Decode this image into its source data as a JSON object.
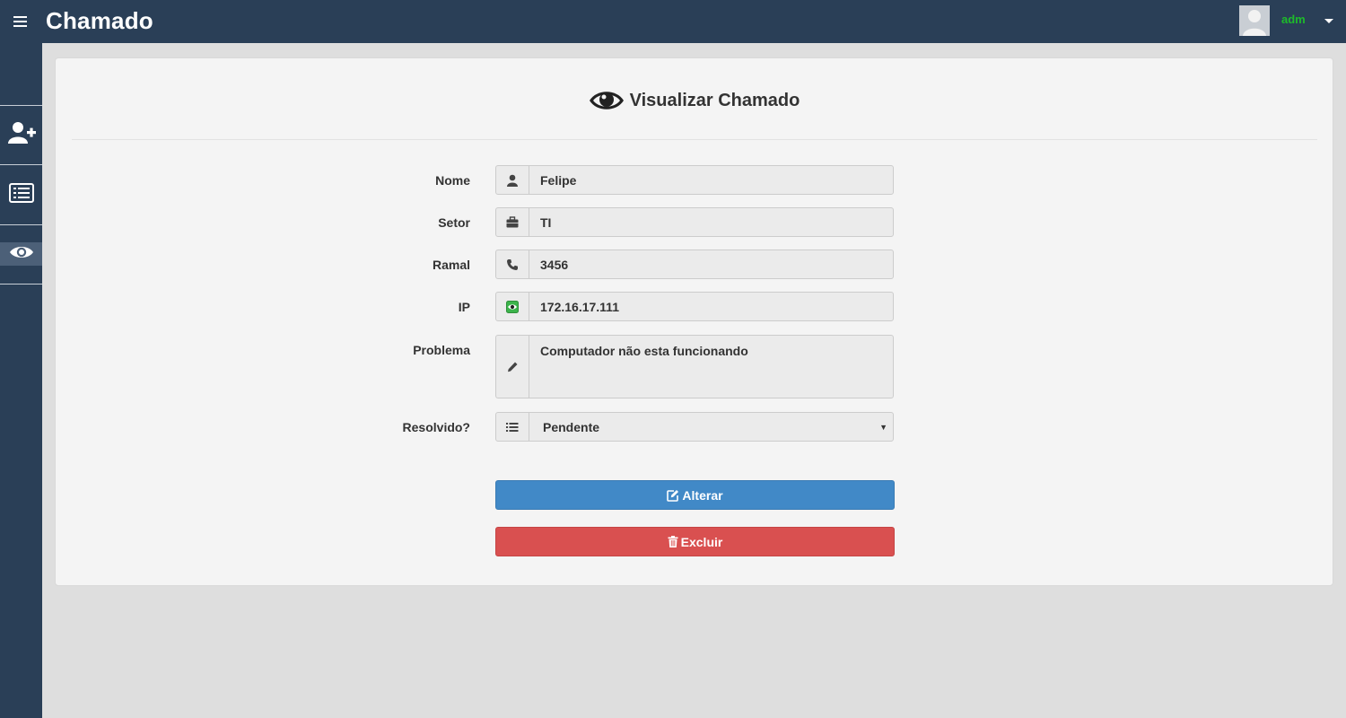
{
  "app": {
    "brand": "Chamado",
    "username": "adm",
    "colors": {
      "topbar": "#2a3f57",
      "username": "#1dbb2a",
      "primary": "#4189c7",
      "danger": "#d95050"
    }
  },
  "sidebar": {
    "items": [
      {
        "icon": "add-user-icon",
        "active": false
      },
      {
        "icon": "list-icon",
        "active": false
      },
      {
        "icon": "eye-icon",
        "active": true
      }
    ]
  },
  "form": {
    "title": "Visualizar Chamado",
    "title_icon": "eye-icon",
    "fields": [
      {
        "label": "Nome",
        "icon": "user-icon",
        "value": "Felipe"
      },
      {
        "label": "Setor",
        "icon": "briefcase-icon",
        "value": "TI"
      },
      {
        "label": "Ramal",
        "icon": "phone-icon",
        "value": "3456"
      },
      {
        "label": "IP",
        "icon": "eye-badge-icon",
        "value": "172.16.17.111"
      },
      {
        "label": "Problema",
        "icon": "pencil-icon",
        "value": "Computador não esta funcionando"
      },
      {
        "label": "Resolvido?",
        "icon": "list-icon",
        "value": "Pendente"
      }
    ],
    "buttons": {
      "alterar": "Alterar",
      "excluir": "Excluir"
    }
  }
}
